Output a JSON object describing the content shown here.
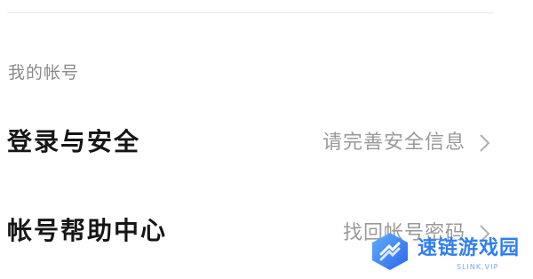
{
  "section": {
    "header": "我的帐号"
  },
  "rows": [
    {
      "title": "登录与安全",
      "hint": "请完善安全信息",
      "icon": "chevron-right-icon"
    },
    {
      "title": "帐号帮助中心",
      "hint": "找回帐号密码",
      "icon": "chevron-right-icon"
    }
  ],
  "watermark": {
    "text": "速链游戏园",
    "subtext": "SLINK.VIP",
    "color": "#2f7ff0"
  }
}
